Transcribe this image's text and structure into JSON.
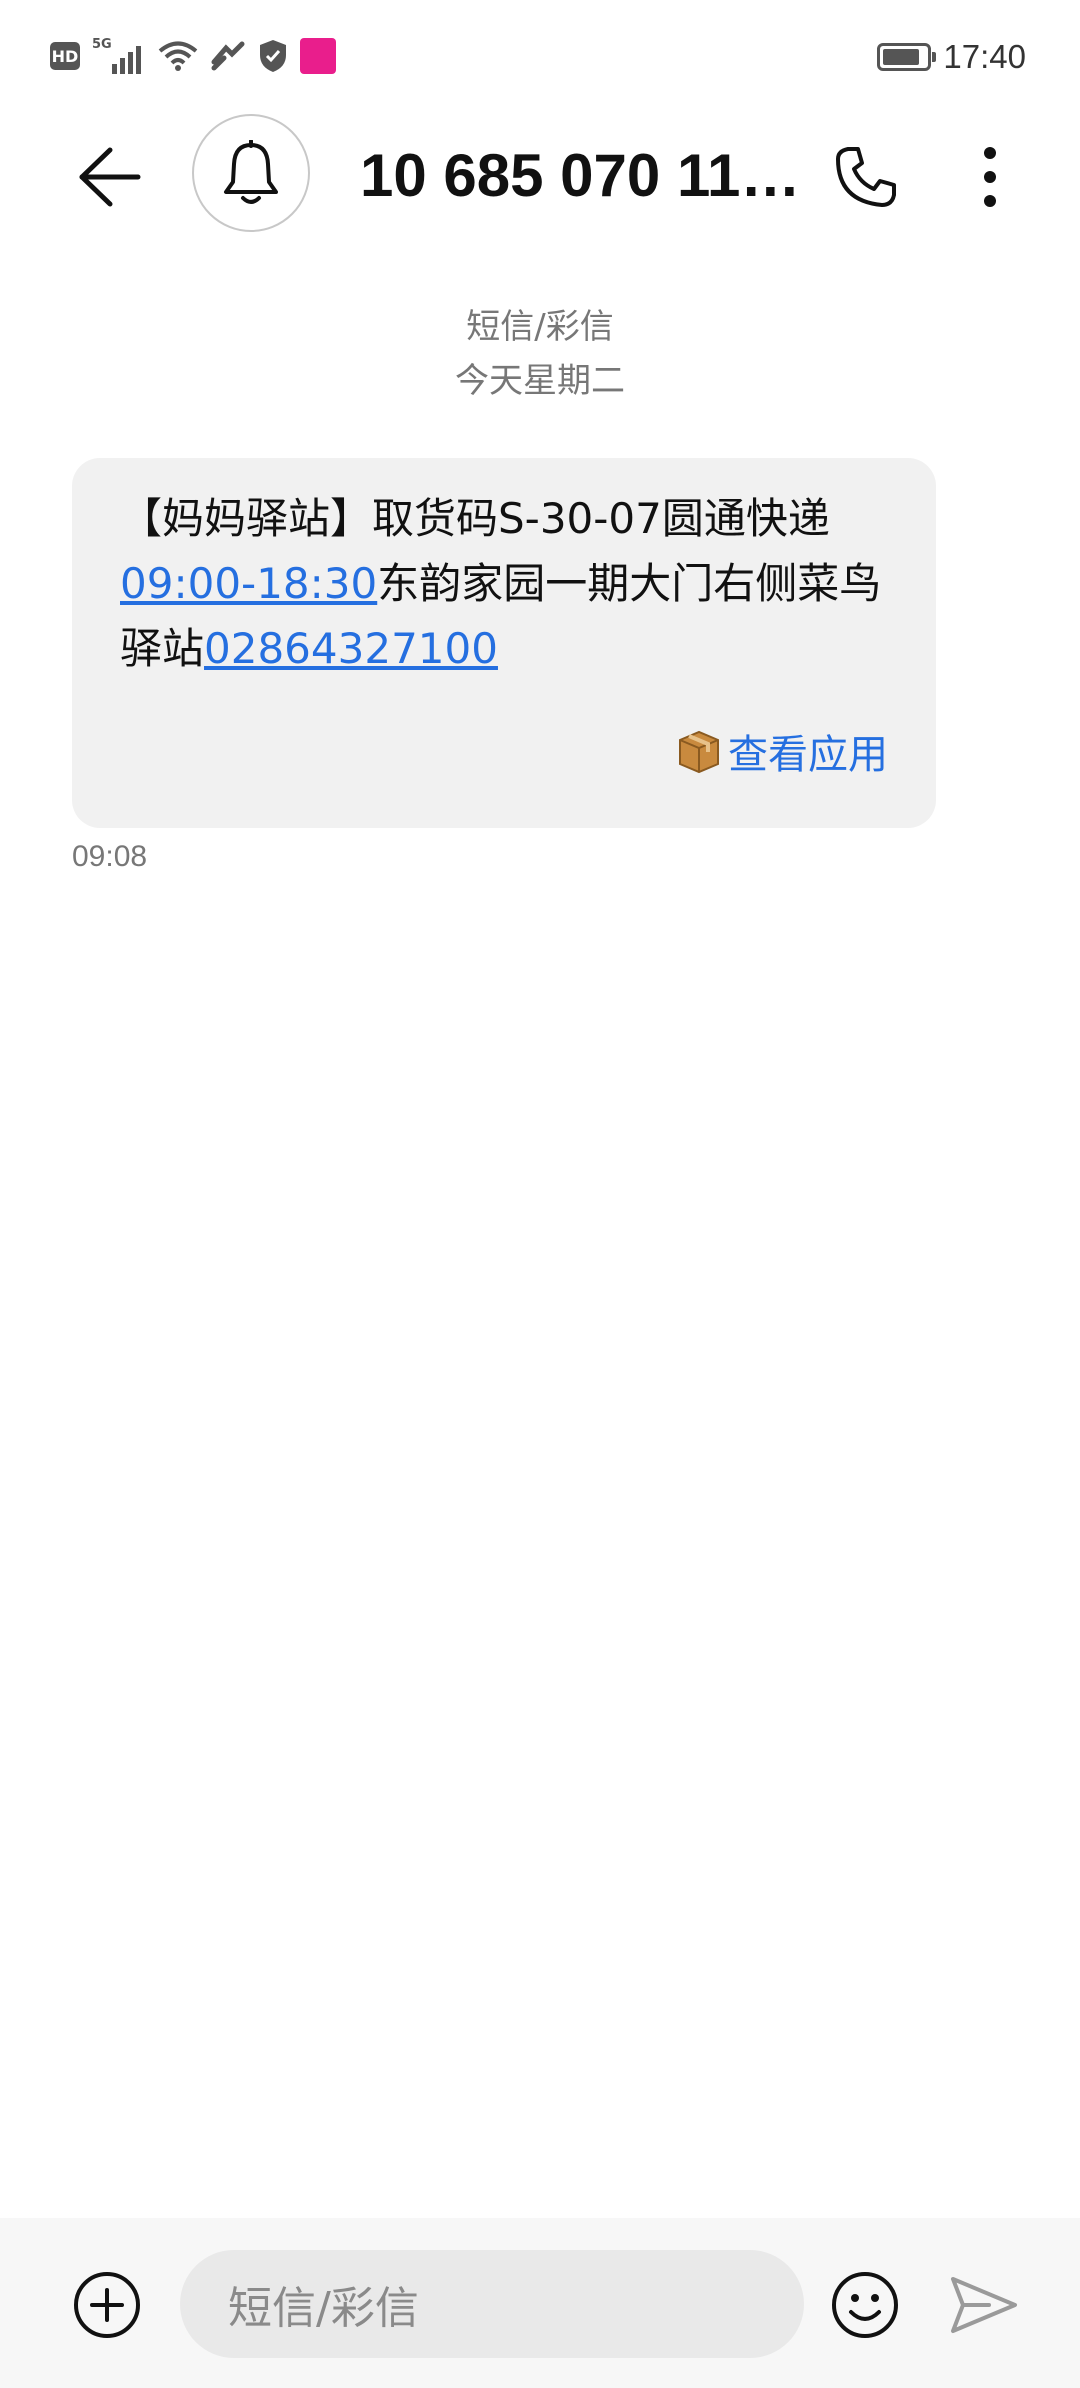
{
  "status_bar": {
    "hd_label": "HD",
    "network_label": "5G",
    "time": "17:40"
  },
  "header": {
    "contact_number": "10 685 070 11…"
  },
  "thread": {
    "message_type": "短信/彩信",
    "date_label": "今天星期二"
  },
  "message": {
    "text_part1": "【妈妈驿站】取货码S-30-07圆通快递",
    "link_hours": "09:00-18:30",
    "text_part2": "东韵家园一期大门右侧菜鸟驿站",
    "link_phone": "02864327100",
    "action_label": "查看应用",
    "timestamp": "09:08"
  },
  "composer": {
    "placeholder": "短信/彩信"
  },
  "colors": {
    "link": "#256fe0",
    "bubble_bg": "#f1f1f1",
    "promo_badge": "#e91e8c"
  },
  "icons": {
    "back": "arrow-left-icon",
    "avatar": "bell-icon",
    "call": "phone-icon",
    "more": "more-vertical-icon",
    "package": "package-icon",
    "attach": "plus-circle-icon",
    "emoji": "smiley-icon",
    "send": "send-icon"
  }
}
